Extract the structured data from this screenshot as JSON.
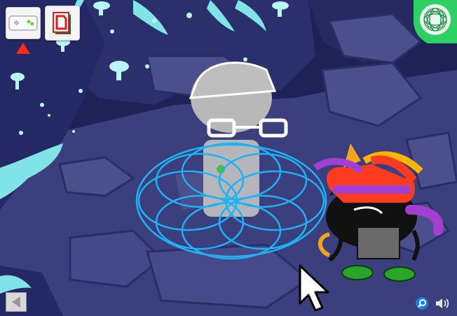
{
  "scene": {
    "location": "",
    "colors": {
      "cave_bg": "#1b1f4a",
      "rock_dark": "#2a2d66",
      "rock_mid": "#3f4385",
      "rock_floor": "#535892",
      "crystal": "#7fe3e8",
      "crystal_light": "#c7fbfb",
      "spirograph": "#1fb3f5",
      "enemy_black": "#111111",
      "shoe_green": "#2aa52a"
    }
  },
  "hud": {
    "controller_button": {
      "icon": "gamepad-icon"
    },
    "save_button": {
      "icon": "sburb-papers-icon"
    },
    "alert_marker": {
      "icon": "red-triangle-icon"
    },
    "spirograph_button": {
      "icon": "spirograph-icon",
      "color": "#2ecf63"
    },
    "back_button": {
      "icon": "left-arrow-icon"
    },
    "zoom_button": {
      "icon": "magnifier-icon"
    },
    "sound_button": {
      "icon": "speaker-icon"
    }
  },
  "characters": {
    "player": {
      "name": "",
      "glasses": "white frames"
    },
    "enemy": {
      "name": "",
      "hat_colors": [
        "#ff3b1f",
        "#ffb400",
        "#33cc33",
        "#9933ff"
      ]
    }
  }
}
